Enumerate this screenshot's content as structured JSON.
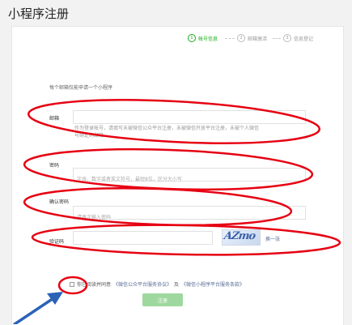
{
  "page": {
    "title": "小程序注册"
  },
  "steps": [
    {
      "num": "1",
      "label": "帐号信息",
      "active": true
    },
    {
      "num": "2",
      "label": "邮箱激活",
      "active": false
    },
    {
      "num": "3",
      "label": "信息登记",
      "active": false
    }
  ],
  "form": {
    "intro": "每个邮箱仅能申请一个小程序",
    "email": {
      "label": "邮箱",
      "value": "",
      "hint": "作为登录帐号，请填写未被微信公众平台注册，未被微信开放平台注册，未被个人微信号绑定的邮箱"
    },
    "password": {
      "label": "密码",
      "value": "",
      "placeholder": "字母、数字或者英文符号，最短8位，区分大小写"
    },
    "confirm": {
      "label": "确认密码",
      "value": "",
      "placeholder": "请再次输入密码"
    },
    "captcha": {
      "label": "验证码",
      "value": "",
      "image_text": "AZmo",
      "refresh_label": "换一张"
    },
    "agree": {
      "prefix": "你已阅读并同意",
      "link1": "《微信公众平台服务协议》",
      "and": "及",
      "link2": "《微信小程序平台服务条款》"
    },
    "submit_label": "注册"
  },
  "colors": {
    "accent": "#1aad19",
    "button_disabled": "#9fd89f",
    "link": "#576b95",
    "annotation": "#e60012"
  }
}
